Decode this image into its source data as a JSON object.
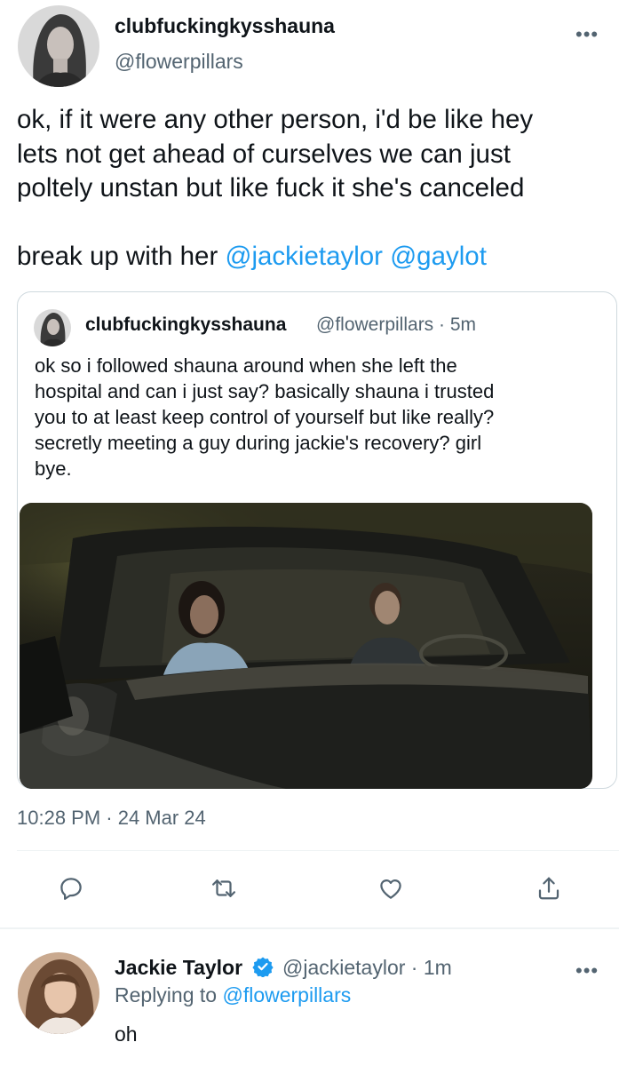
{
  "tweet": {
    "author_name": "clubfuckingkysshauna",
    "author_handle": "@flowerpillars",
    "more_label": "•••",
    "text_lines": [
      "ok, if it were any other person, i'd be like hey",
      "lets not get ahead of curselves we can just",
      "poltely unstan but like fuck it she's canceled"
    ],
    "line4_prefix": "break up with her ",
    "mention1": "@jackietaylor",
    "mention2": "@gaylot",
    "timestamp": "10:28 PM · 24 Mar 24"
  },
  "quoted_tweet": {
    "author_name": "clubfuckingkysshauna",
    "author_meta": "@flowerpillars · 5m",
    "text_lines": [
      "ok so i followed shauna around when she left the",
      "hospital and can i just say? basically shauna i trusted",
      "you to at least keep control of yourself but like really?",
      "secretly meeting a guy during jackie's recovery? girl",
      "bye."
    ]
  },
  "actions": [
    "reply-icon",
    "retweet-icon",
    "like-icon",
    "share-icon"
  ],
  "reply": {
    "author_name": "Jackie Taylor",
    "author_meta": "@jackietaylor · 1m",
    "replying_prefix": "Replying to ",
    "replying_to": "@flowerpillars",
    "text": "oh",
    "more_label": "•••"
  },
  "colors": {
    "accent": "#1d9bf0",
    "secondary_text": "#536471",
    "primary_text": "#0f1419",
    "border": "#cfd9de"
  }
}
